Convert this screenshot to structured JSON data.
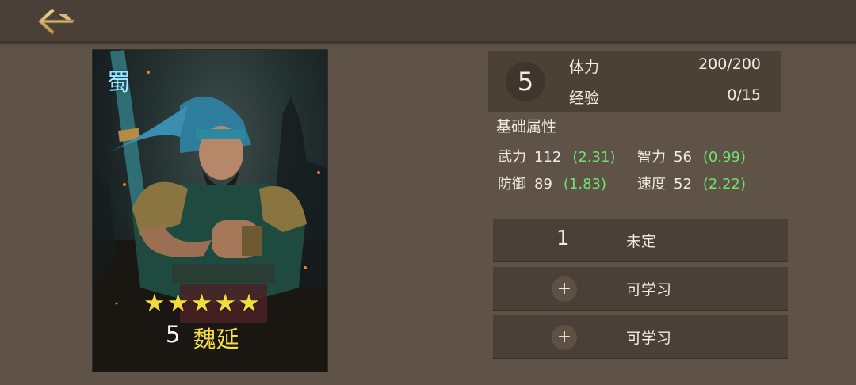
{
  "nav": {
    "back_icon": "back-arrow-icon"
  },
  "hero": {
    "faction": "蜀",
    "stars": 5,
    "star_glyph": "★",
    "level": "5",
    "name": "魏延"
  },
  "status": {
    "level": "5",
    "stamina_label": "体力",
    "stamina_value": "200/200",
    "exp_label": "经验",
    "exp_value": "0/15"
  },
  "attributes": {
    "title": "基础属性",
    "items": [
      {
        "name": "武力",
        "value": "112",
        "bonus": "(2.31)"
      },
      {
        "name": "智力",
        "value": "56",
        "bonus": "(0.99)"
      },
      {
        "name": "防御",
        "value": "89",
        "bonus": "(1.83)"
      },
      {
        "name": "速度",
        "value": "52",
        "bonus": "(2.22)"
      }
    ]
  },
  "skills": [
    {
      "number": "1",
      "label": "未定"
    },
    {
      "icon": "+",
      "label": "可学习"
    },
    {
      "icon": "+",
      "label": "可学习"
    }
  ],
  "colors": {
    "background": "#5e5346",
    "panel": "#4a4037",
    "bonus_green": "#6fe36f",
    "hero_name_yellow": "#f5e04a",
    "star_yellow": "#f2dc3a",
    "faction_blue": "#9fe3ff"
  }
}
